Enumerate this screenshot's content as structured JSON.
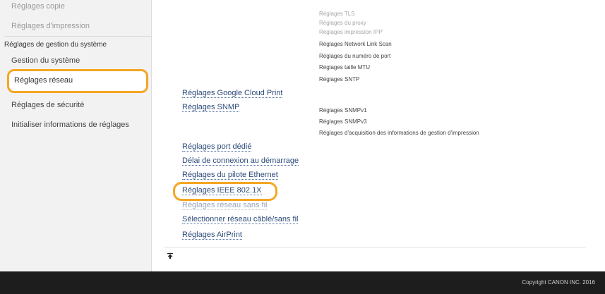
{
  "sidebar": {
    "item_copy": "Réglages copie",
    "item_print": "Réglages d'impression",
    "section_header": "Réglages de gestion du système",
    "item_system": "Gestion du système",
    "item_network": "Réglages réseau",
    "item_security": "Réglages de sécurité",
    "item_init": "Initialiser informations de réglages"
  },
  "main": {
    "upper_subitems": [
      "Réglages TLS",
      "Réglages du proxy",
      "Réglages impression IPP",
      "Réglages Network Link Scan",
      "Réglages du numéro de port",
      "Réglages taille MTU",
      "Réglages SNTP"
    ],
    "links": {
      "google_cloud_print": "Réglages Google Cloud Print",
      "snmp": "Réglages SNMP",
      "dedicated_port": "Réglages port dédié",
      "startup_delay": "Délai de connexion au démarrage",
      "ethernet_driver": "Réglages du pilote Ethernet",
      "ieee8021x": "Réglages IEEE 802.1X",
      "wireless": "Réglages réseau sans fil",
      "select_network": "Sélectionner réseau câblé/sans fil",
      "airprint": "Réglages AirPrint"
    },
    "snmp_subitems": [
      "Réglages SNMPv1",
      "Réglages SNMPv3",
      "Réglages d'acquisition des informations de gestion d'impression"
    ],
    "top_icon": "top-arrow-icon"
  },
  "footer": {
    "copyright": "Copyright CANON INC. 2016"
  },
  "colors": {
    "highlight": "#f5a623",
    "footer_bg": "#1d1d1d",
    "sidebar_bg": "#f2f2f2",
    "link": "#2c4a78"
  }
}
